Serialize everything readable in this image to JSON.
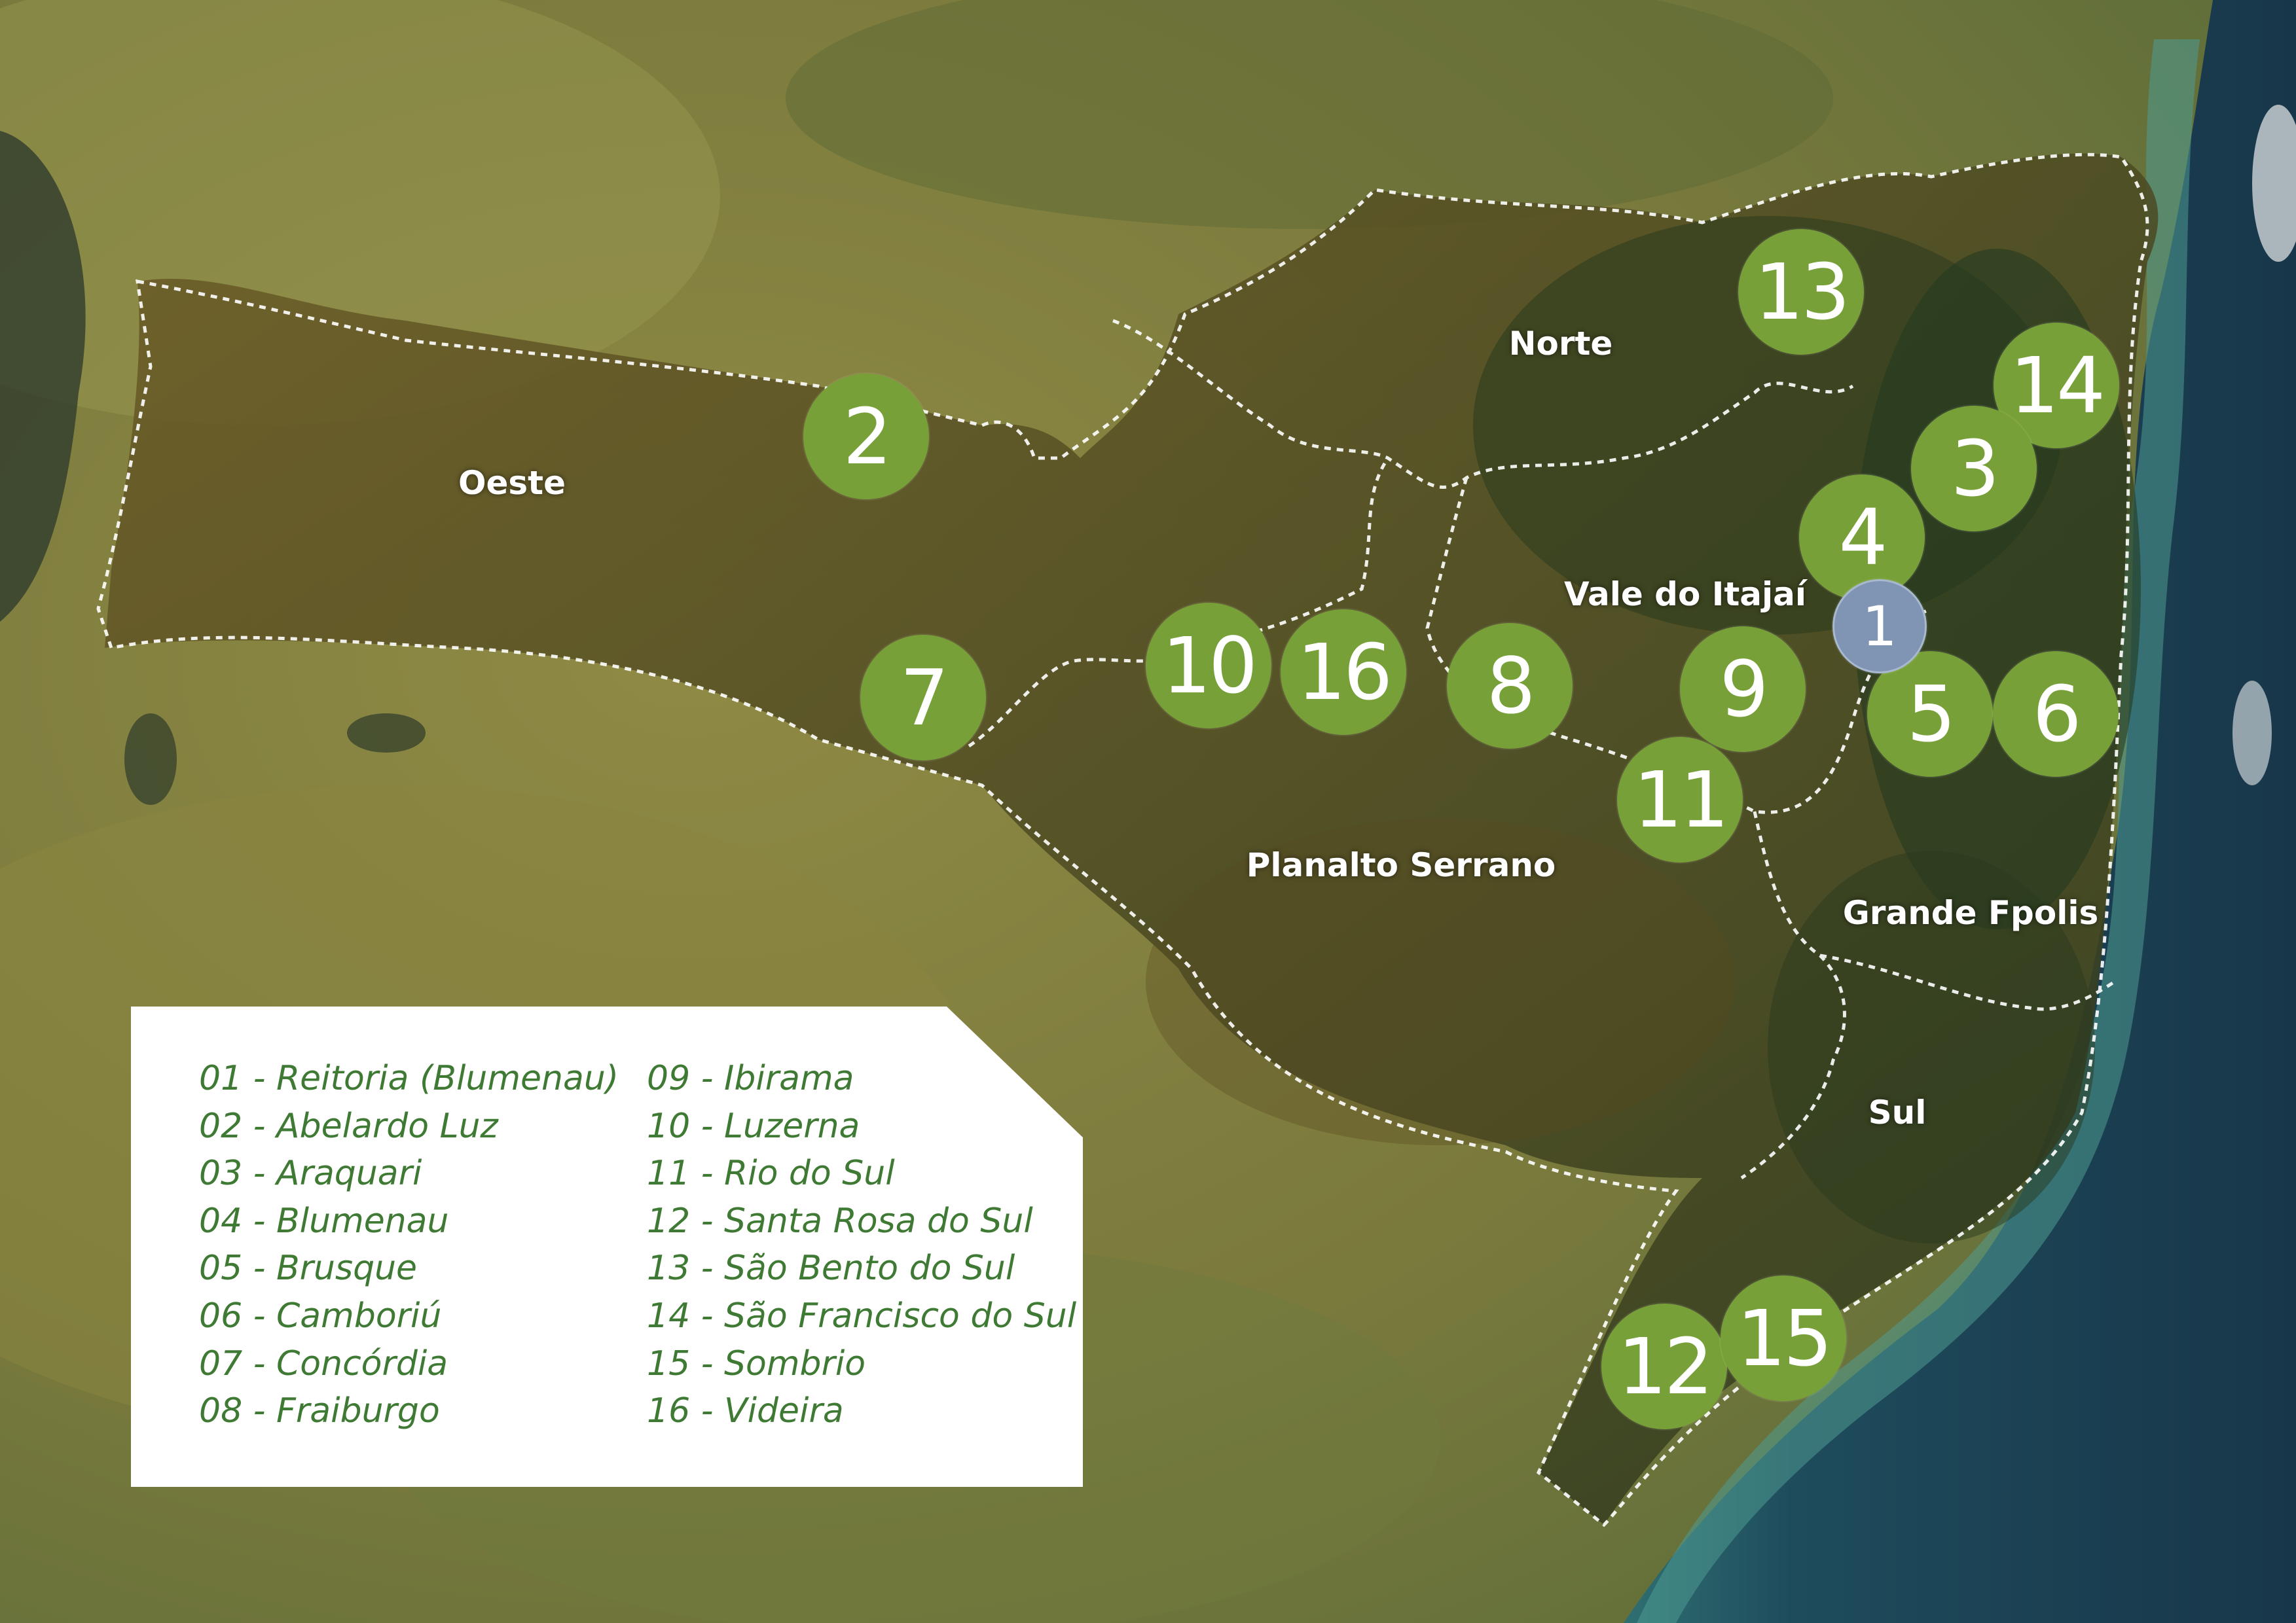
{
  "colors": {
    "marker_green": "#78a038",
    "marker_headquarters": "#7f95b3",
    "legend_text": "#3f7a34",
    "legend_background": "#ffffff",
    "boundary_line": "#ffffff",
    "ocean": "#1f3d4e"
  },
  "regions": [
    {
      "id": "oeste",
      "label": "Oeste"
    },
    {
      "id": "norte",
      "label": "Norte"
    },
    {
      "id": "vale",
      "label": "Vale do Itajaí"
    },
    {
      "id": "planalto",
      "label": "Planalto Serrano"
    },
    {
      "id": "grande-fpolis",
      "label": "Grande Fpolis"
    },
    {
      "id": "sul",
      "label": "Sul"
    }
  ],
  "markers": [
    {
      "number": "1",
      "type": "headquarters"
    },
    {
      "number": "2",
      "type": "campus"
    },
    {
      "number": "3",
      "type": "campus"
    },
    {
      "number": "4",
      "type": "campus"
    },
    {
      "number": "5",
      "type": "campus"
    },
    {
      "number": "6",
      "type": "campus"
    },
    {
      "number": "7",
      "type": "campus"
    },
    {
      "number": "8",
      "type": "campus"
    },
    {
      "number": "9",
      "type": "campus"
    },
    {
      "number": "10",
      "type": "campus"
    },
    {
      "number": "11",
      "type": "campus"
    },
    {
      "number": "12",
      "type": "campus"
    },
    {
      "number": "13",
      "type": "campus"
    },
    {
      "number": "14",
      "type": "campus"
    },
    {
      "number": "15",
      "type": "campus"
    },
    {
      "number": "16",
      "type": "campus"
    }
  ],
  "legend": {
    "column1": [
      "01 - Reitoria (Blumenau)",
      "02 - Abelardo Luz",
      "03 - Araquari",
      "04 - Blumenau",
      "05 - Brusque",
      "06 - Camboriú",
      "07 - Concórdia",
      "08 - Fraiburgo"
    ],
    "column2": [
      "09 - Ibirama",
      "10 - Luzerna",
      "11 - Rio do Sul",
      "12 - Santa Rosa do Sul",
      "13 - São Bento do Sul",
      "14 - São Francisco do Sul",
      "15 - Sombrio",
      "16 - Videira"
    ]
  }
}
